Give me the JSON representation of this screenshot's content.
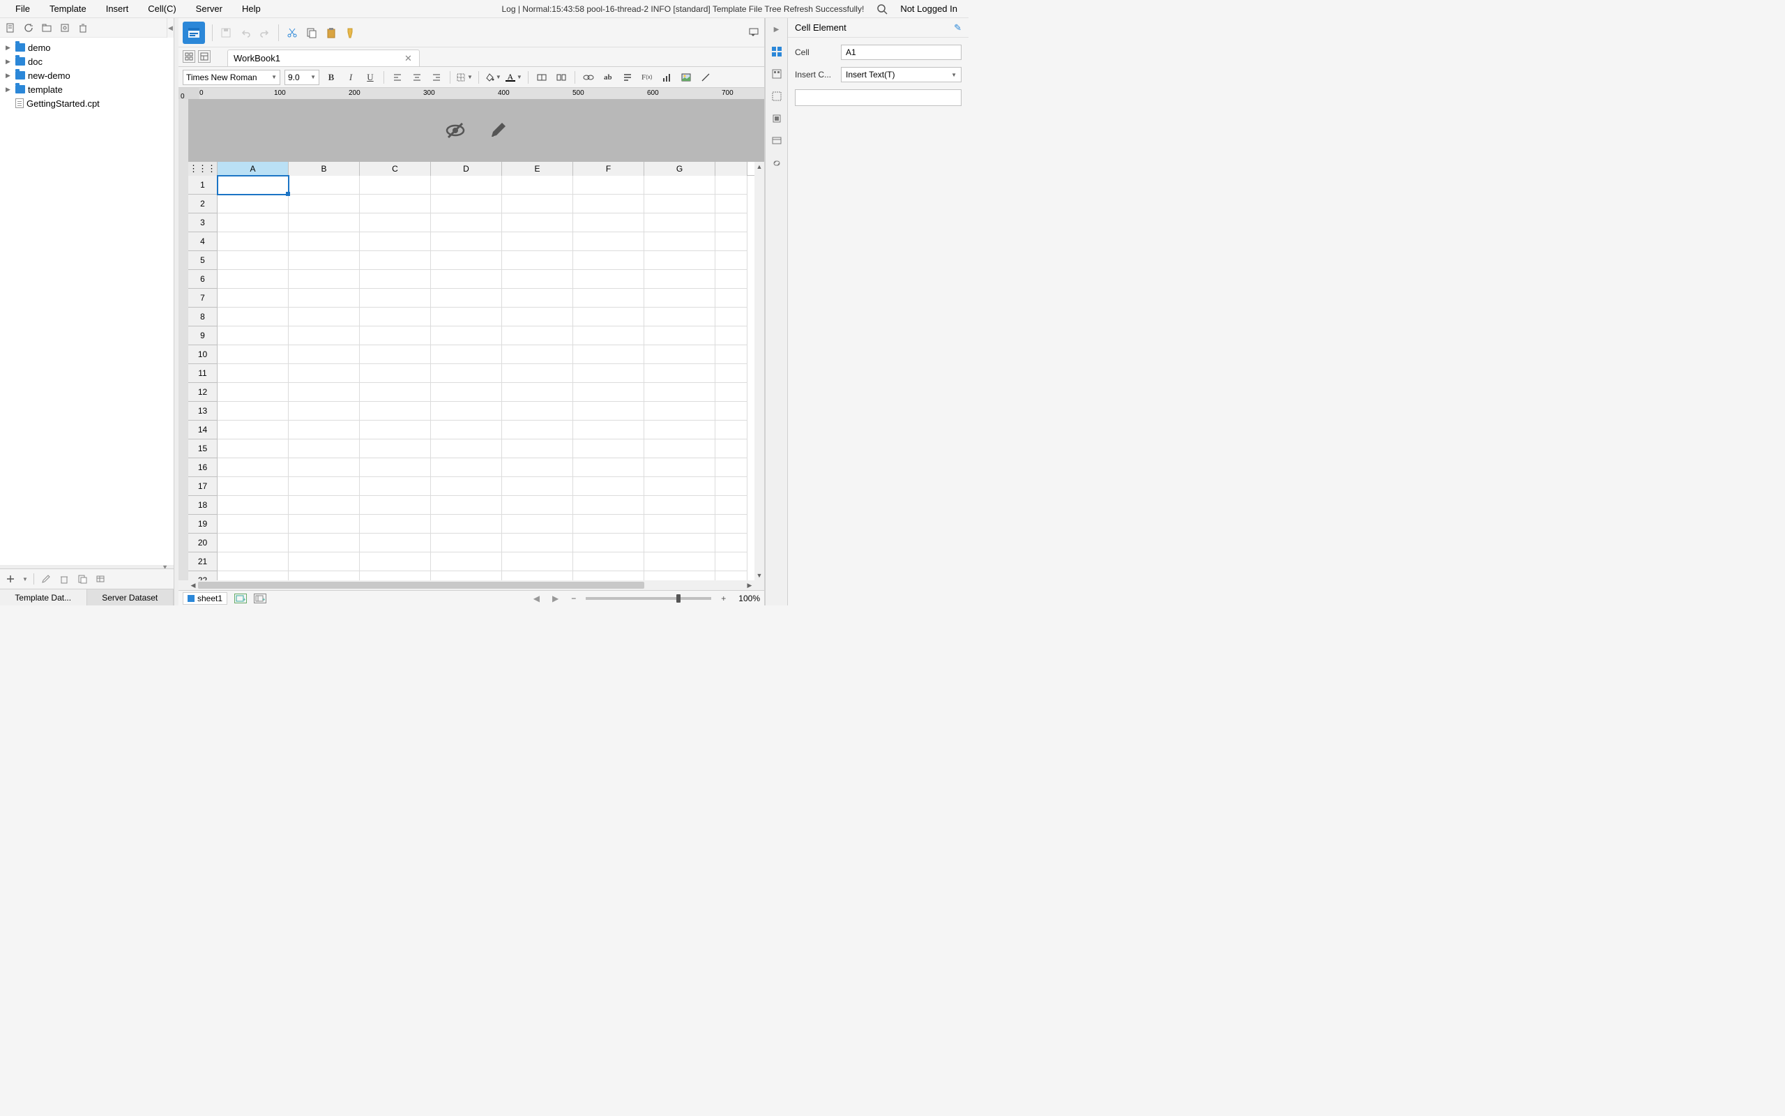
{
  "menubar": {
    "file": "File",
    "template": "Template",
    "insert": "Insert",
    "cell": "Cell(C)",
    "server": "Server",
    "help": "Help",
    "log_text": "Log | Normal:15:43:58 pool-16-thread-2 INFO [standard] Template File Tree Refresh Successfully!",
    "login_status": "Not Logged In"
  },
  "file_tree": {
    "items": [
      "demo",
      "doc",
      "new-demo",
      "template"
    ],
    "file": "GettingStarted.cpt"
  },
  "dataset_tabs": {
    "template": "Template Dat...",
    "server": "Server Dataset"
  },
  "doc_tab": {
    "name": "WorkBook1"
  },
  "font": {
    "name": "Times New Roman",
    "size": "9.0"
  },
  "ruler_marks": [
    "0",
    "100",
    "200",
    "300",
    "400",
    "500",
    "600",
    "700"
  ],
  "grid": {
    "columns": [
      "A",
      "B",
      "C",
      "D",
      "E",
      "F",
      "G"
    ],
    "row_count": 22,
    "selected_cell": "A1"
  },
  "sheet_tab": {
    "name": "sheet1"
  },
  "zoom": {
    "label": "100%"
  },
  "right_panel": {
    "title": "Cell Element",
    "cell_label": "Cell",
    "cell_value": "A1",
    "insert_label": "Insert C...",
    "insert_value": "Insert Text(T)"
  }
}
